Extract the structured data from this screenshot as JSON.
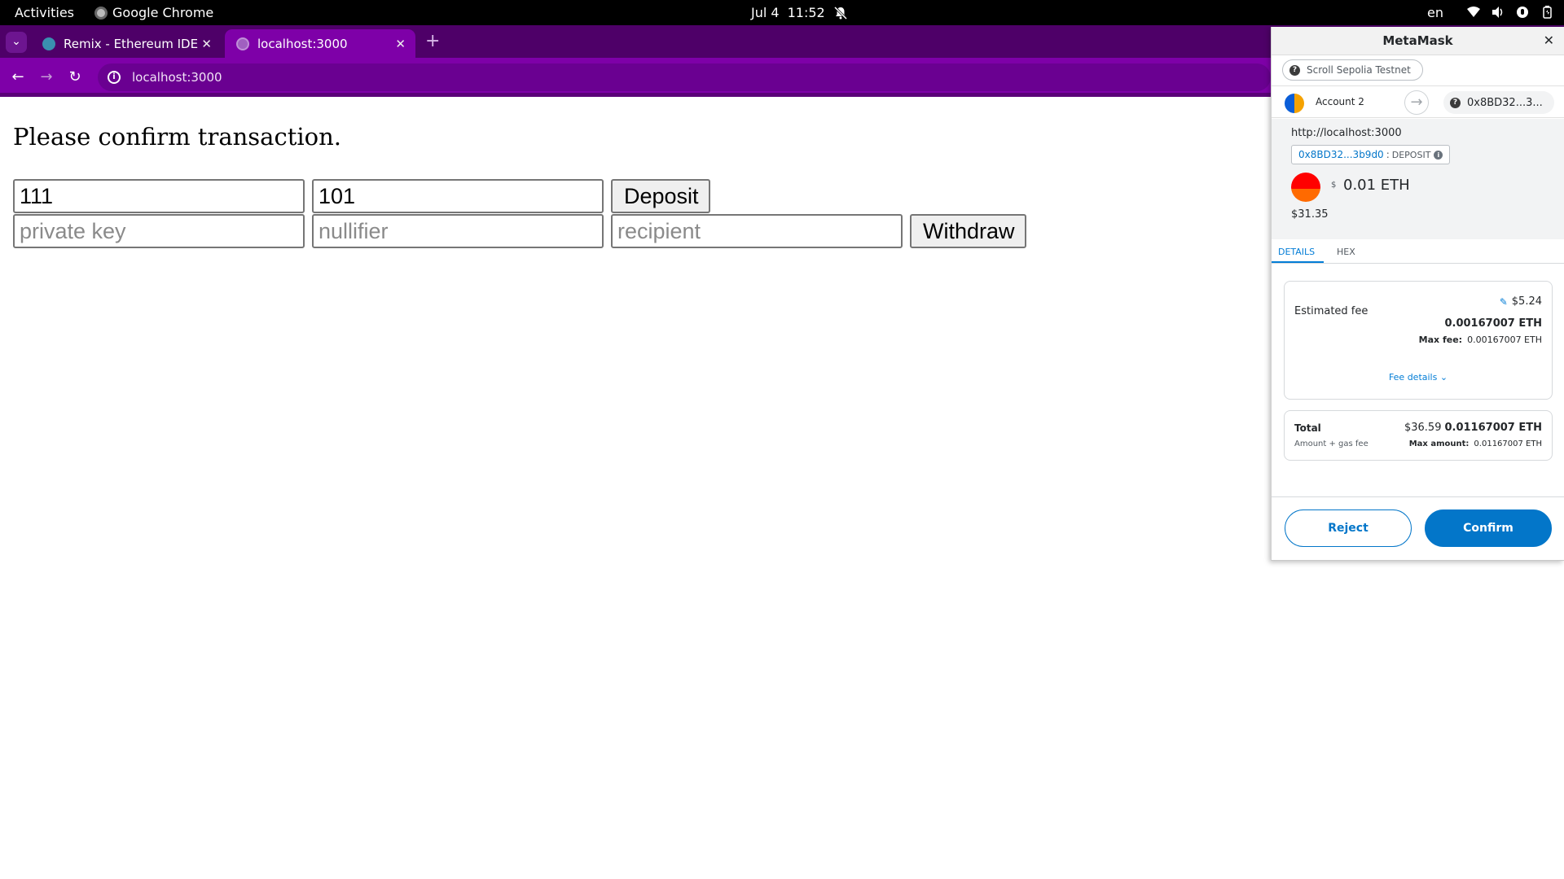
{
  "topbar": {
    "activities": "Activities",
    "app_name": "Google Chrome",
    "date": "Jul 4",
    "time": "11:52",
    "lang": "en"
  },
  "tabs": [
    {
      "title": "Remix - Ethereum IDE"
    },
    {
      "title": "localhost:3000"
    }
  ],
  "address_bar": {
    "url": "localhost:3000"
  },
  "page": {
    "heading": "Please confirm transaction.",
    "deposit_field_1": "111",
    "deposit_field_2": "101",
    "deposit_button": "Deposit",
    "private_key_placeholder": "private key",
    "nullifier_placeholder": "nullifier",
    "recipient_placeholder": "recipient",
    "withdraw_button": "Withdraw"
  },
  "metamask": {
    "title": "MetaMask",
    "network": "Scroll Sepolia Testnet",
    "account_name": "Account 2",
    "recipient": "0x8BD32...3...",
    "origin": "http://localhost:3000",
    "contract_address": "0x8BD32...3b9d0",
    "method": "DEPOSIT",
    "currency_symbol": "$",
    "amount": "0.01 ETH",
    "amount_fiat": "$31.35",
    "tab_details": "DETAILS",
    "tab_hex": "HEX",
    "estimated_fee_label": "Estimated fee",
    "estimated_fee_fiat": "$5.24",
    "estimated_fee_eth": "0.00167007 ETH",
    "max_fee_label": "Max fee:",
    "max_fee_value": "0.00167007 ETH",
    "fee_details_link": "Fee details",
    "total_label": "Total",
    "total_sub": "Amount + gas fee",
    "total_fiat": "$36.59",
    "total_eth": "0.01167007 ETH",
    "max_amount_label": "Max amount:",
    "max_amount_value": "0.01167007 ETH",
    "reject_button": "Reject",
    "confirm_button": "Confirm"
  },
  "colors": {
    "chrome_frame": "#4e0068",
    "chrome_toolbar": "#7e00a8",
    "metamask_blue": "#0376c9"
  }
}
